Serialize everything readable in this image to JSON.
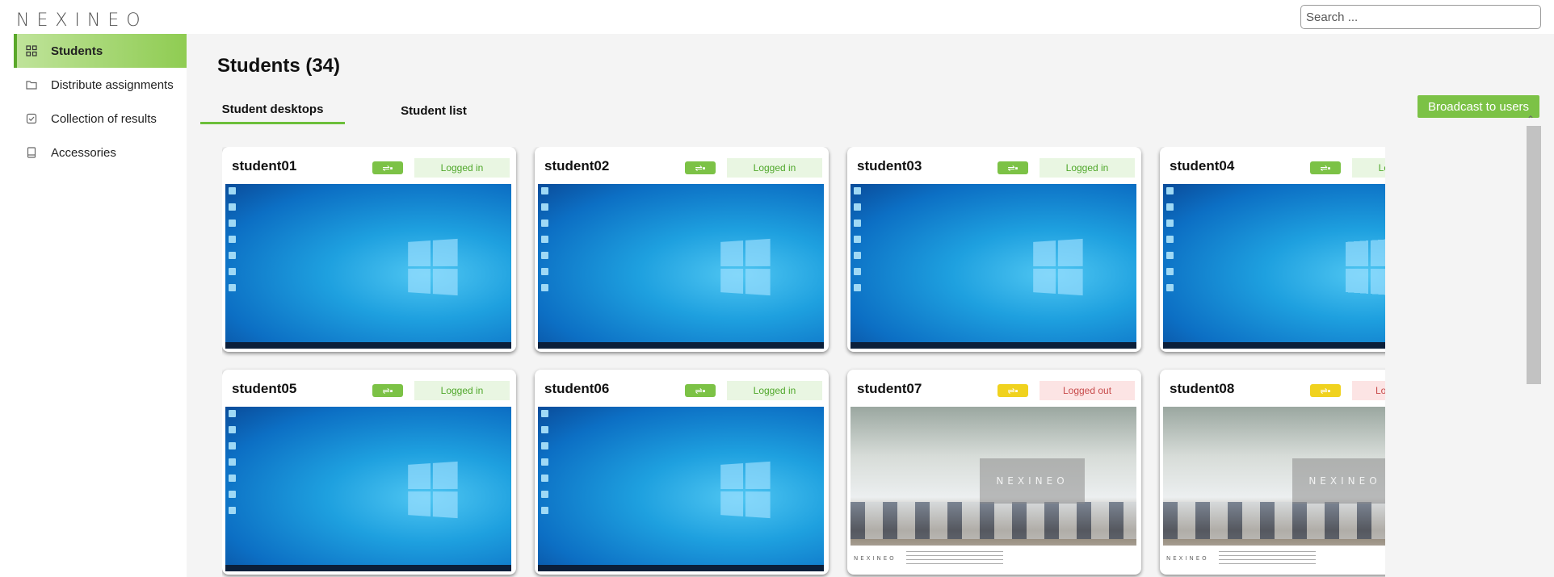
{
  "app": {
    "logo_text": "NEXINEO"
  },
  "search": {
    "placeholder": "Search ..."
  },
  "sidebar": {
    "items": [
      {
        "label": "Students",
        "icon": "grid-icon",
        "active": true
      },
      {
        "label": "Distribute assignments",
        "icon": "folder-icon",
        "active": false
      },
      {
        "label": "Collection of results",
        "icon": "checkbox-icon",
        "active": false
      },
      {
        "label": "Accessories",
        "icon": "tablet-icon",
        "active": false
      }
    ]
  },
  "main": {
    "title": "Students (34)",
    "tabs": [
      {
        "label": "Student desktops",
        "active": true
      },
      {
        "label": "Student list",
        "active": false
      }
    ],
    "broadcast_label": "Broadcast to users"
  },
  "students": [
    {
      "name": "student01",
      "status": "Logged in",
      "usb": "green",
      "screen": "windows-desktop"
    },
    {
      "name": "student02",
      "status": "Logged in",
      "usb": "green",
      "screen": "windows-desktop"
    },
    {
      "name": "student03",
      "status": "Logged in",
      "usb": "green",
      "screen": "windows-desktop"
    },
    {
      "name": "student04",
      "status": "Logged in",
      "usb": "green",
      "screen": "windows-desktop"
    },
    {
      "name": "student05",
      "status": "Logged in",
      "usb": "green",
      "screen": "windows-desktop"
    },
    {
      "name": "student06",
      "status": "Logged in",
      "usb": "green",
      "screen": "windows-desktop"
    },
    {
      "name": "student07",
      "status": "Logged out",
      "usb": "yellow",
      "screen": "login-screen"
    },
    {
      "name": "student08",
      "status": "Logged out",
      "usb": "yellow",
      "screen": "login-screen"
    }
  ],
  "colors": {
    "accent": "#7cc246",
    "logged_in_bg": "#e9f6e2",
    "logged_in_text": "#4fa72a",
    "logged_out_bg": "#fce4e4",
    "logged_out_text": "#c74b4b"
  }
}
